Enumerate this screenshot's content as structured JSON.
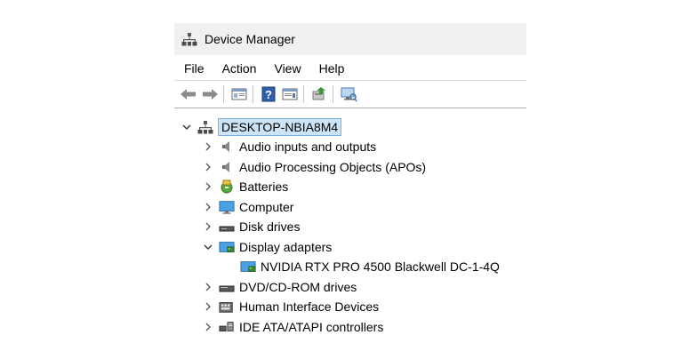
{
  "window": {
    "title": "Device Manager"
  },
  "menu": [
    "File",
    "Action",
    "View",
    "Help"
  ],
  "toolbar": {
    "icons": [
      "back-icon",
      "forward-icon",
      "show-hide-console-tree-icon",
      "help-icon",
      "properties-icon",
      "update-driver-icon",
      "scan-hardware-icon"
    ]
  },
  "tree": {
    "root": "DESKTOP-NBIA8M4",
    "items": [
      {
        "label": "Audio inputs and outputs",
        "icon": "speaker-icon"
      },
      {
        "label": "Audio Processing Objects (APOs)",
        "icon": "speaker-icon"
      },
      {
        "label": "Batteries",
        "icon": "battery-icon"
      },
      {
        "label": "Computer",
        "icon": "monitor-icon"
      },
      {
        "label": "Disk drives",
        "icon": "disk-drive-icon"
      },
      {
        "label": "Display adapters",
        "icon": "display-adapter-icon",
        "expanded": true
      },
      {
        "label": "NVIDIA RTX PRO 4500 Blackwell DC-1-4Q",
        "icon": "display-adapter-icon",
        "child": true
      },
      {
        "label": "DVD/CD-ROM drives",
        "icon": "dvd-drive-icon"
      },
      {
        "label": "Human Interface Devices",
        "icon": "hid-icon"
      },
      {
        "label": "IDE ATA/ATAPI controllers",
        "icon": "ide-controller-icon"
      }
    ]
  }
}
